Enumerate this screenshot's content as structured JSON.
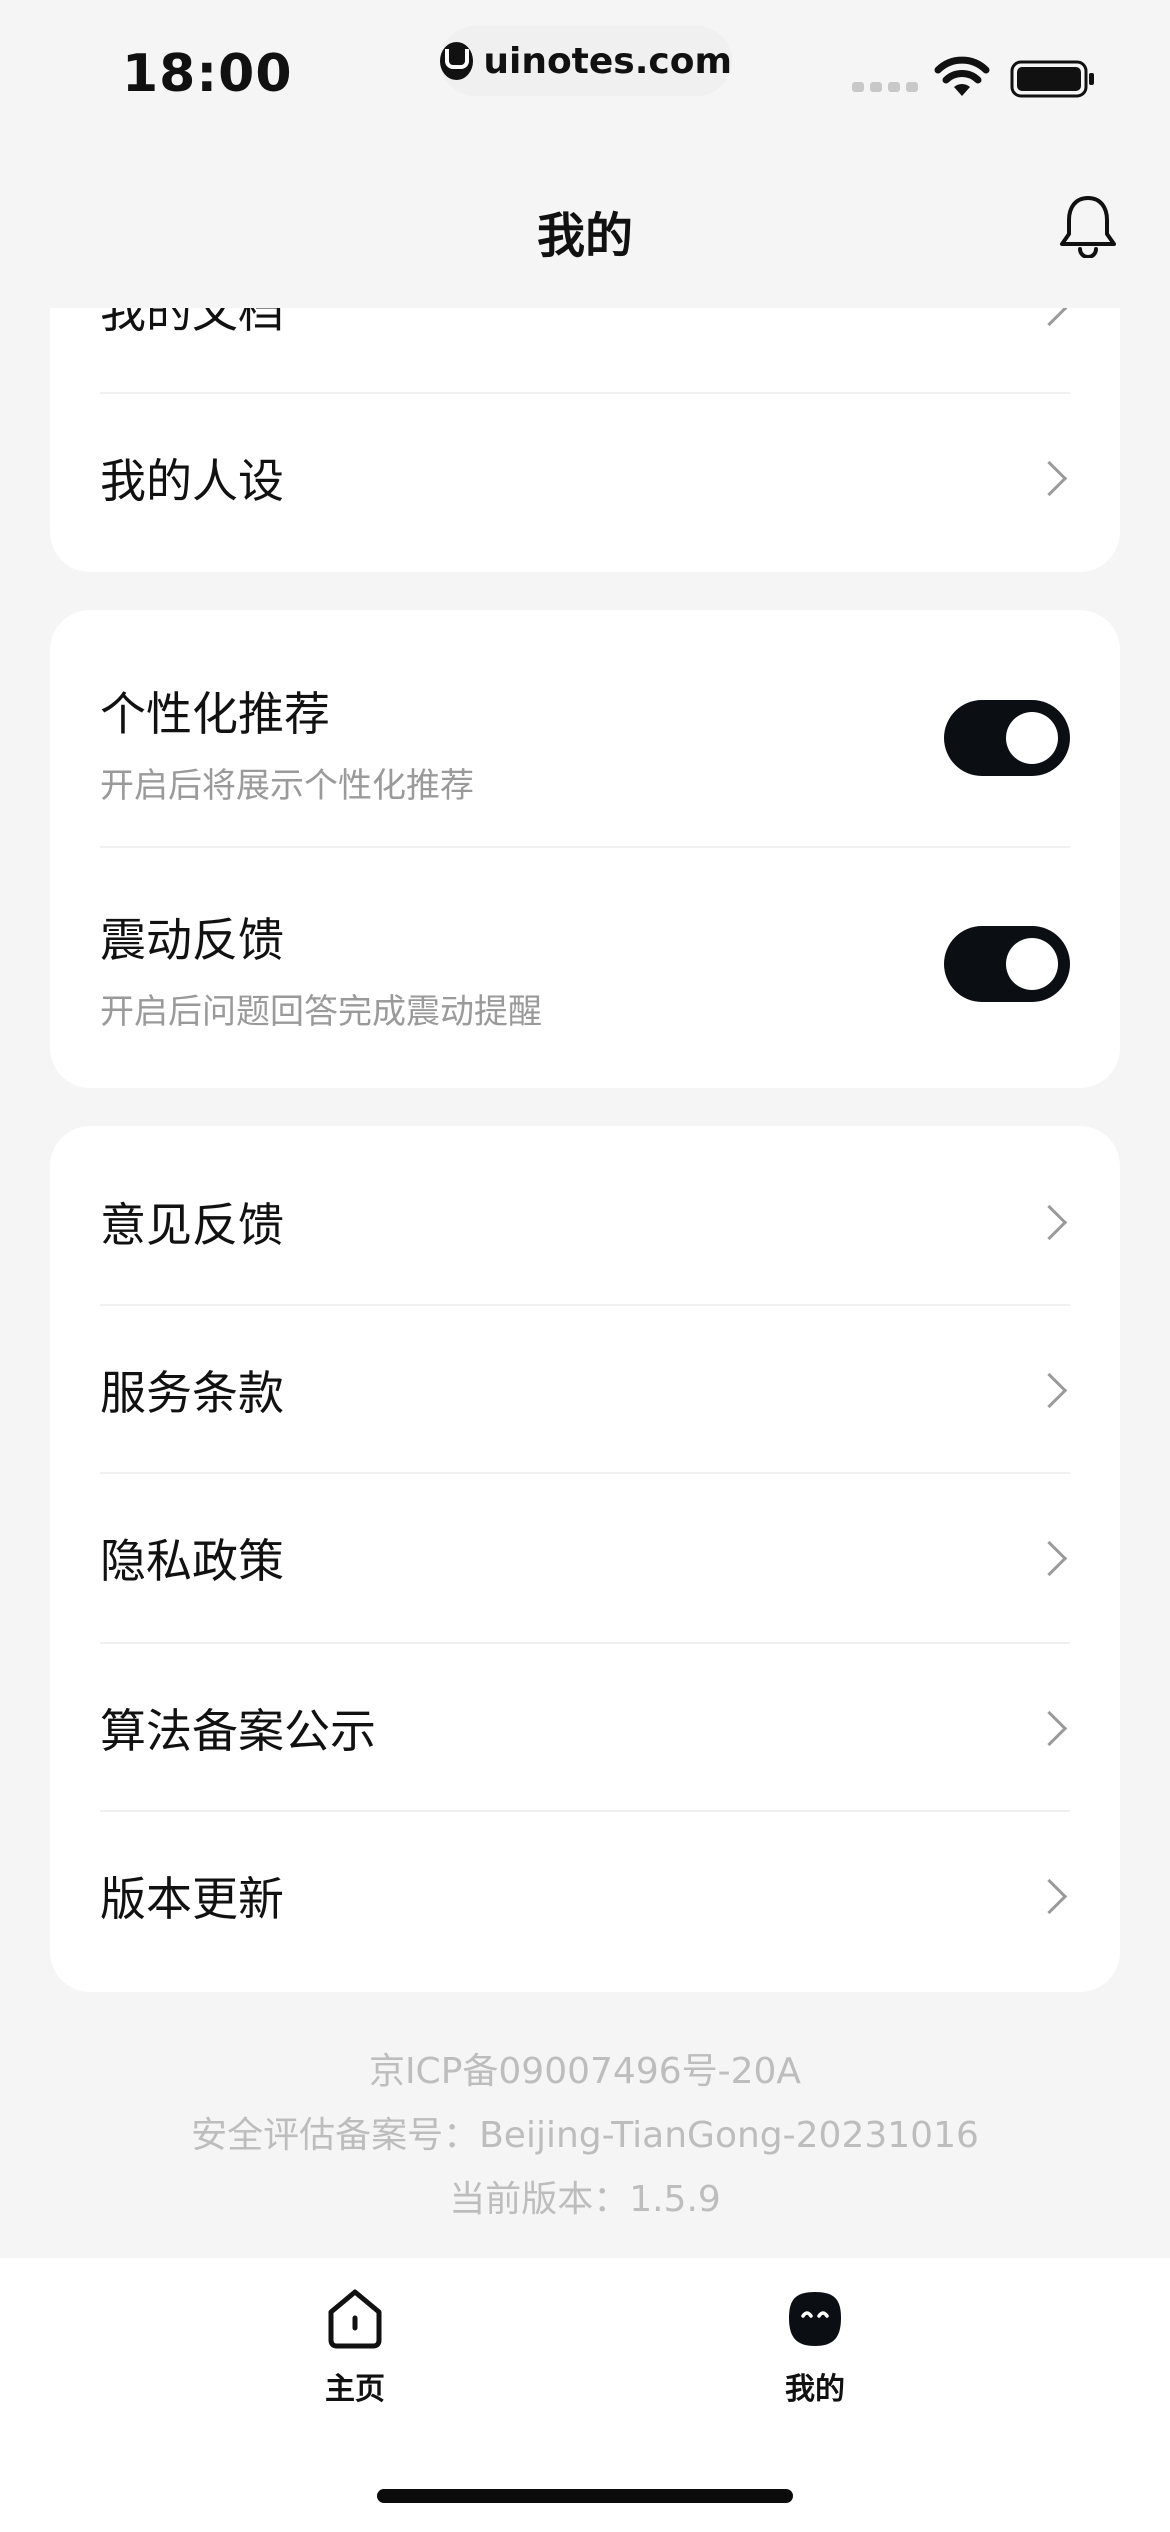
{
  "status_bar": {
    "time": "18:00",
    "url": "uinotes.com"
  },
  "header": {
    "title": "我的"
  },
  "card1": {
    "items": [
      {
        "label": "我的文档"
      },
      {
        "label": "我的人设"
      }
    ]
  },
  "card2": {
    "toggles": [
      {
        "title": "个性化推荐",
        "subtitle": "开启后将展示个性化推荐",
        "enabled": true
      },
      {
        "title": "震动反馈",
        "subtitle": "开启后问题回答完成震动提醒",
        "enabled": true
      }
    ]
  },
  "card3": {
    "items": [
      {
        "label": "意见反馈"
      },
      {
        "label": "服务条款"
      },
      {
        "label": "隐私政策"
      },
      {
        "label": "算法备案公示"
      },
      {
        "label": "版本更新"
      }
    ]
  },
  "footer": {
    "icp": "京ICP备09007496号-20A",
    "security": "安全评估备案号：Beijing-TianGong-20231016",
    "version": "当前版本：1.5.9"
  },
  "tabbar": {
    "tabs": [
      {
        "label": "主页",
        "icon": "home-icon"
      },
      {
        "label": "我的",
        "icon": "profile-icon"
      }
    ]
  }
}
